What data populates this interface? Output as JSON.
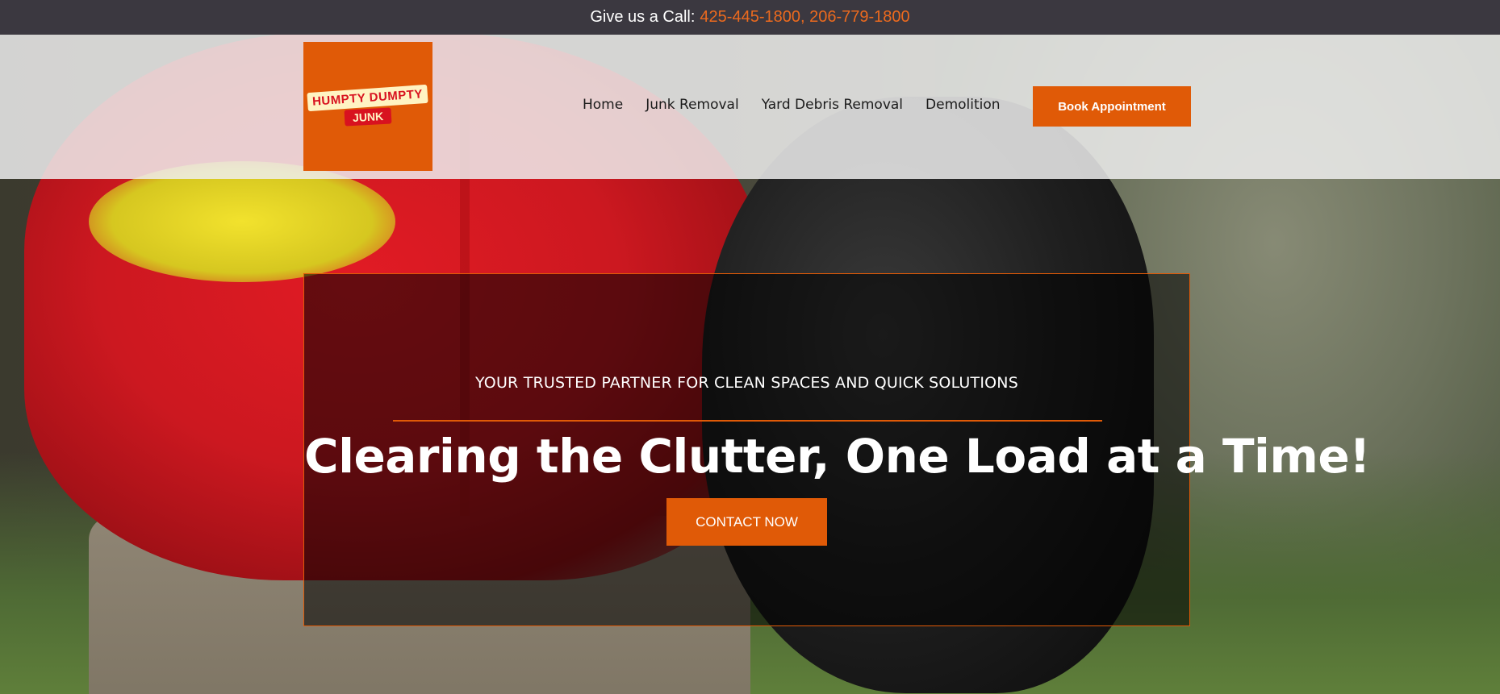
{
  "topbar": {
    "label": "Give us a Call:",
    "phones": "425-445-1800, 206-779-1800"
  },
  "logo": {
    "line1": "HUMPTY DUMPTY",
    "line2": "JUNK"
  },
  "nav": {
    "items": [
      {
        "label": "Home"
      },
      {
        "label": "Junk Removal"
      },
      {
        "label": "Yard Debris Removal"
      },
      {
        "label": "Demolition"
      }
    ]
  },
  "header": {
    "book_label": "Book Appointment"
  },
  "hero": {
    "tagline": "YOUR TRUSTED PARTNER FOR CLEAN SPACES AND QUICK SOLUTIONS",
    "headline": "Clearing the Clutter, One Load at a Time!",
    "cta_label": "CONTACT NOW"
  },
  "colors": {
    "accent": "#e05a07",
    "topbar_bg": "#3b3840",
    "phone_text": "#ec6a1e"
  }
}
